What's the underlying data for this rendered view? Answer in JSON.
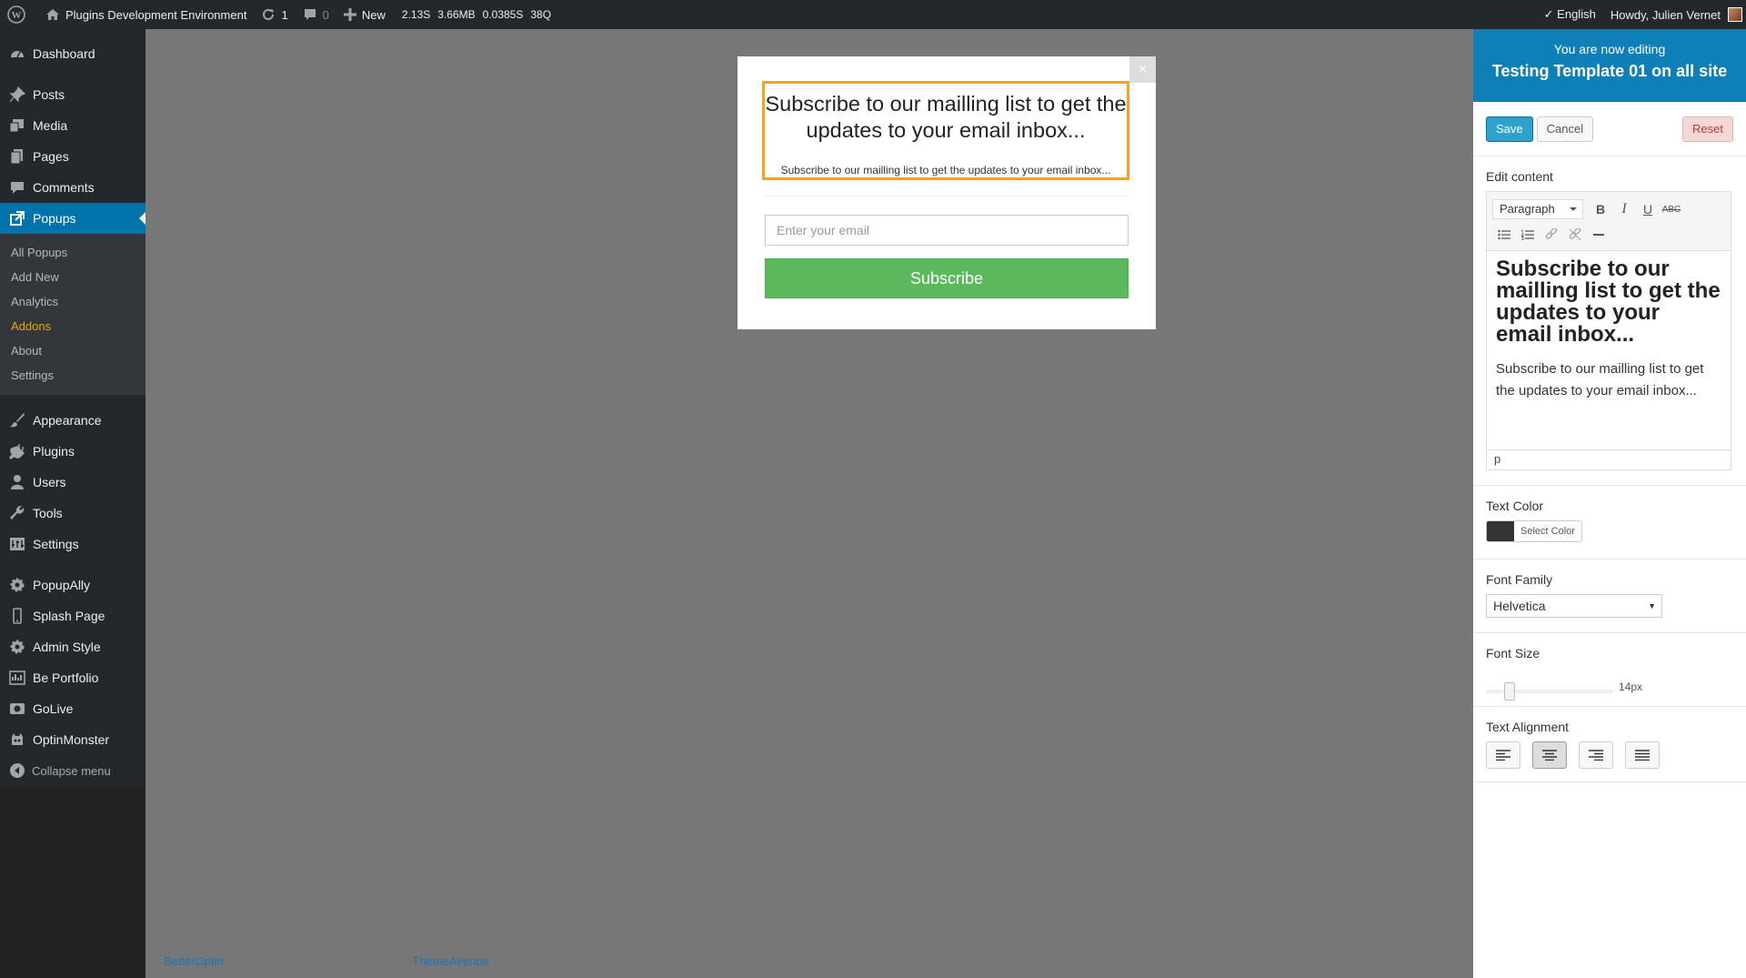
{
  "adminbar": {
    "site_name": "Plugins Development Environment",
    "updates_count": "1",
    "comments_count": "0",
    "new_label": "New",
    "stats": [
      "2.13S",
      "3.66MB",
      "0.0385S",
      "38Q"
    ],
    "language": "✓ English",
    "howdy": "Howdy, Julien Vernet"
  },
  "sidebar": {
    "items_top": [
      {
        "label": "Dashboard",
        "icon": "dashboard-icon"
      }
    ],
    "items_main": [
      {
        "label": "Posts",
        "icon": "pin-icon"
      },
      {
        "label": "Media",
        "icon": "media-icon"
      },
      {
        "label": "Pages",
        "icon": "pages-icon"
      },
      {
        "label": "Comments",
        "icon": "comments-icon"
      },
      {
        "label": "Popups",
        "icon": "popups-icon"
      }
    ],
    "submenu": [
      "All Popups",
      "Add New",
      "Analytics",
      "Addons",
      "About",
      "Settings"
    ],
    "items_bottom": [
      {
        "label": "Appearance",
        "icon": "brush-icon"
      },
      {
        "label": "Plugins",
        "icon": "plugin-icon"
      },
      {
        "label": "Users",
        "icon": "user-icon"
      },
      {
        "label": "Tools",
        "icon": "wrench-icon"
      },
      {
        "label": "Settings",
        "icon": "settings-icon"
      }
    ],
    "items_extra": [
      {
        "label": "PopupAlly",
        "icon": "gear-icon"
      },
      {
        "label": "Splash Page",
        "icon": "phone-icon"
      },
      {
        "label": "Admin Style",
        "icon": "gear-icon"
      },
      {
        "label": "Be Portfolio",
        "icon": "portfolio-icon"
      },
      {
        "label": "GoLive",
        "icon": "golive-icon"
      },
      {
        "label": "OptinMonster",
        "icon": "monster-icon"
      }
    ],
    "collapse": "Collapse menu"
  },
  "footer": {
    "link1": "BetterOptin",
    "link2": "ThemeAvenue"
  },
  "popup": {
    "headline": "Subscribe to our mailling list to get the updates to your email inbox...",
    "body": "Subscribe to our mailling list to get the updates to your email inbox...",
    "email_placeholder": "Enter your email",
    "button": "Subscribe",
    "close": "×"
  },
  "panel": {
    "editing_line1": "You are now editing",
    "editing_line2": "Testing Template 01 on all site",
    "save": "Save",
    "cancel": "Cancel",
    "reset": "Reset",
    "edit_content_title": "Edit content",
    "format_select": "Paragraph",
    "editor_heading": "Subscribe to our mailling list to get the updates to your email inbox...",
    "editor_paragraph": "Subscribe to our mailling list to get the updates to your email inbox...",
    "editor_path": "p",
    "text_color_title": "Text Color",
    "select_color": "Select Color",
    "text_color_value": "#333333",
    "font_family_title": "Font Family",
    "font_family_value": "Helvetica",
    "font_size_title": "Font Size",
    "font_size_value": "14px",
    "text_alignment_title": "Text Alignment",
    "alignment_selected": "center"
  }
}
